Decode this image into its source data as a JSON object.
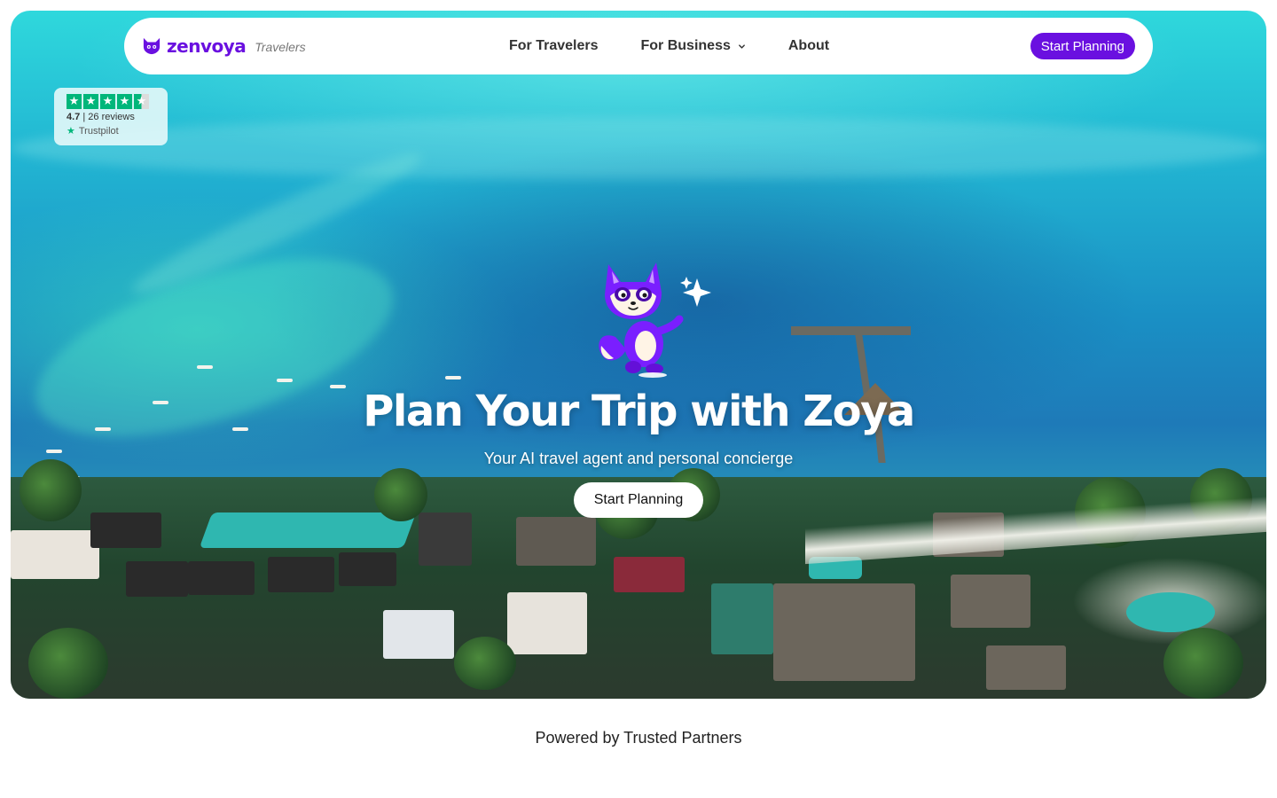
{
  "header": {
    "brand_name": "zenvoya",
    "brand_sub": "Travelers",
    "nav": [
      {
        "label": "For Travelers",
        "has_dropdown": false
      },
      {
        "label": "For Business",
        "has_dropdown": true
      },
      {
        "label": "About",
        "has_dropdown": false
      }
    ],
    "cta_label": "Start Planning"
  },
  "trustpilot": {
    "rating_value": 4.7,
    "rating_label": "4.7",
    "reviews_label": "26 reviews",
    "source": "Trustpilot"
  },
  "hero": {
    "headline": "Plan Your Trip with Zoya",
    "subheadline": "Your AI travel agent and personal concierge",
    "cta_label": "Start Planning",
    "background": "aerial-beach-resort-ocean"
  },
  "partners": {
    "label": "Powered by Trusted Partners"
  },
  "icons": {
    "brand": "fox-logo-icon",
    "dropdown": "chevron-down-icon",
    "mascot": "fox-mascot-illustration",
    "sparkle": "sparkle-icon",
    "star": "star-icon"
  },
  "colors": {
    "brand": "#6a10e0",
    "trustpilot": "#00b67a",
    "white": "#ffffff"
  }
}
